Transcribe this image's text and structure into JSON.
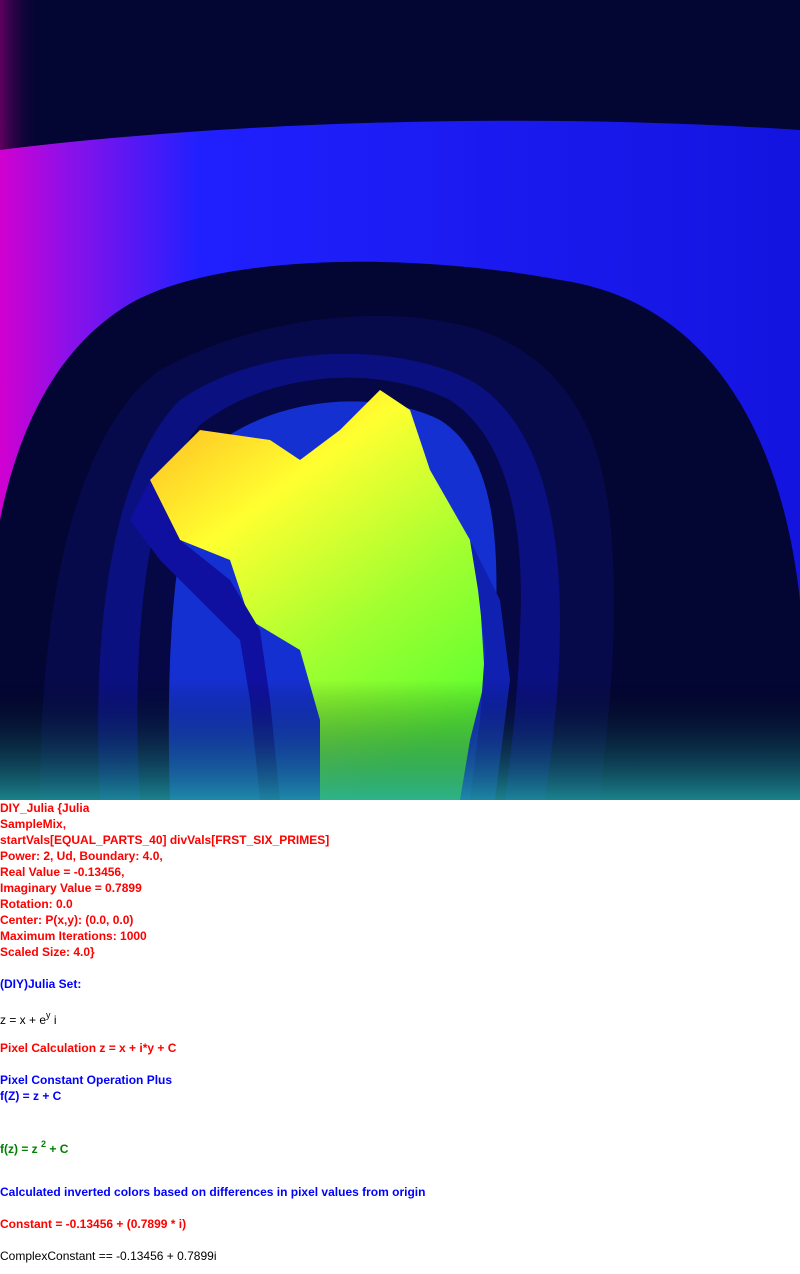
{
  "image": {
    "name": "Julia set fractal render",
    "colors": {
      "background": "#030533",
      "band_blue": "#1a1aff",
      "magenta": "#d400d4",
      "yellow": "#ffff33",
      "green": "#88ff22",
      "teal": "#22aaaa"
    }
  },
  "params": {
    "line1": "DIY_Julia {Julia",
    "line2": "SampleMix,",
    "line3": "startVals[EQUAL_PARTS_40] divVals[FRST_SIX_PRIMES]",
    "line4": "Power: 2, Ud, Boundary: 4.0,",
    "line5": "Real Value = -0.13456,",
    "line6": "Imaginary Value = 0.7899",
    "line7": "Rotation: 0.0",
    "line8": "Center: P(x,y): (0.0, 0.0)",
    "line9": "Maximum Iterations: 1000",
    "line10": "Scaled Size: 4.0}"
  },
  "set_name": "(DIY)Julia Set:",
  "formula_z": {
    "prefix": "z = x + e",
    "sup": "y",
    "suffix": " i"
  },
  "pixel_calc": "Pixel Calculation z = x + i*y + C",
  "pixel_const_op": "Pixel Constant Operation Plus",
  "fz": "f(Z) = z + C",
  "fz2": {
    "prefix": "f(z) = z ",
    "sup": "2",
    "suffix": " + C"
  },
  "inverted_note": "Calculated inverted colors based on differences in pixel values from origin",
  "constant": "Constant = -0.13456 + (0.7899 * i)",
  "complex_constant": "ComplexConstant == -0.13456 + 0.7899i"
}
